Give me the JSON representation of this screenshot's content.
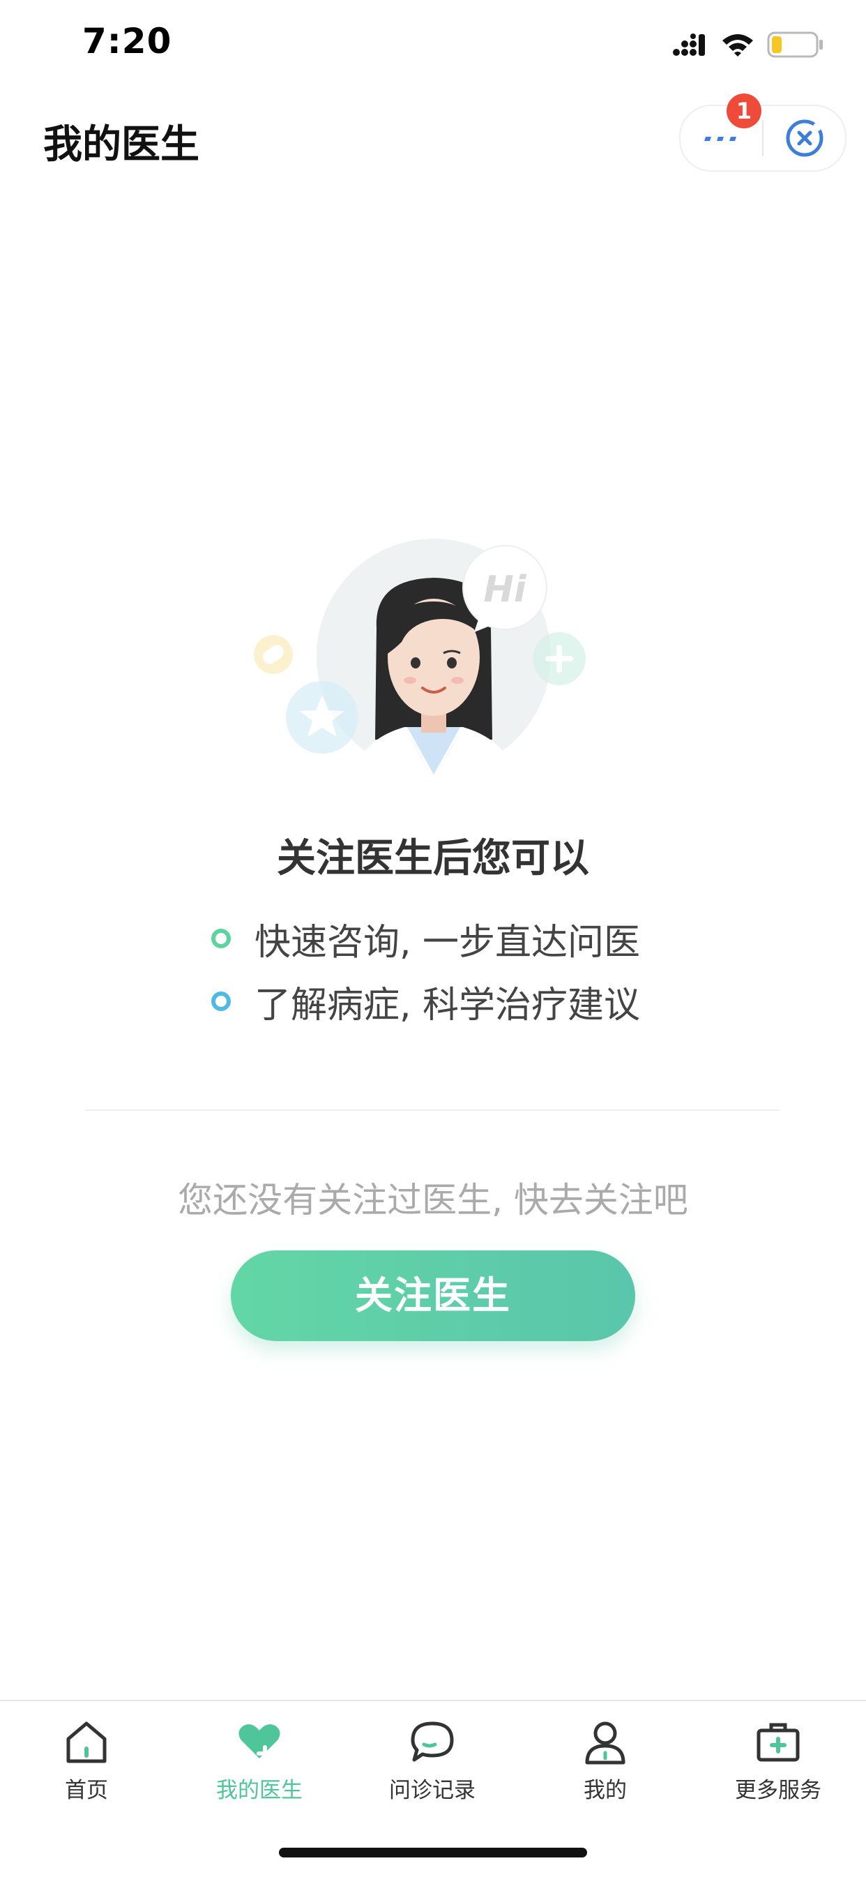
{
  "status_bar": {
    "time": "7:20"
  },
  "header": {
    "title": "我的医生",
    "badge_count": "1"
  },
  "illustration": {
    "bubble_text": "Hi"
  },
  "promo": {
    "title": "关注医生后您可以",
    "benefits": [
      {
        "text": "快速咨询, 一步直达问医",
        "dot_color": "#5dd3a0"
      },
      {
        "text": "了解病症, 科学治疗建议",
        "dot_color": "#4fb9e6"
      }
    ]
  },
  "empty_state": {
    "hint": "您还没有关注过医生, 快去关注吧",
    "button_label": "关注医生"
  },
  "tabbar": {
    "items": [
      {
        "label": "首页",
        "icon": "home-icon"
      },
      {
        "label": "我的医生",
        "icon": "heart-plus-icon",
        "active": true
      },
      {
        "label": "问诊记录",
        "icon": "chat-bubble-icon"
      },
      {
        "label": "我的",
        "icon": "person-icon"
      },
      {
        "label": "更多服务",
        "icon": "medical-kit-icon"
      }
    ]
  },
  "colors": {
    "accent": "#4fc59a",
    "button_gradient_start": "#63d6a6",
    "button_gradient_end": "#5ac6ab",
    "badge": "#ee4b3b"
  }
}
